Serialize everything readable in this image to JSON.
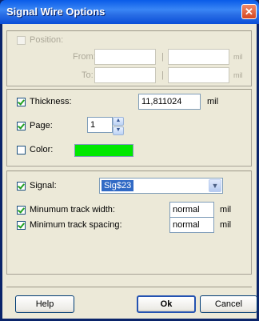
{
  "window": {
    "title": "Signal Wire Options",
    "close_glyph": "✕"
  },
  "position_group": {
    "checkbox_label": "Position:",
    "checked": false,
    "enabled": false,
    "from_label": "From:",
    "to_label": "To:",
    "separator": "|",
    "unit": "mil",
    "from_x": "",
    "from_y": "",
    "to_x": "",
    "to_y": ""
  },
  "properties_group": {
    "thickness": {
      "label": "Thickness:",
      "checked": true,
      "value": "11,811024",
      "unit": "mil"
    },
    "page": {
      "label": "Page:",
      "checked": true,
      "value": "1"
    },
    "color": {
      "label": "Color:",
      "checked": false,
      "swatch_color": "#00e800"
    }
  },
  "signal_group": {
    "signal": {
      "label": "Signal:",
      "checked": true,
      "selected": "Sig$23"
    },
    "min_track_width": {
      "label": "Minumum track width:",
      "checked": true,
      "value": "normal",
      "unit": "mil"
    },
    "min_track_spacing": {
      "label": "Minimum track spacing:",
      "checked": true,
      "value": "normal",
      "unit": "mil"
    }
  },
  "buttons": {
    "help": "Help",
    "ok": "Ok",
    "cancel": "Cancel"
  }
}
